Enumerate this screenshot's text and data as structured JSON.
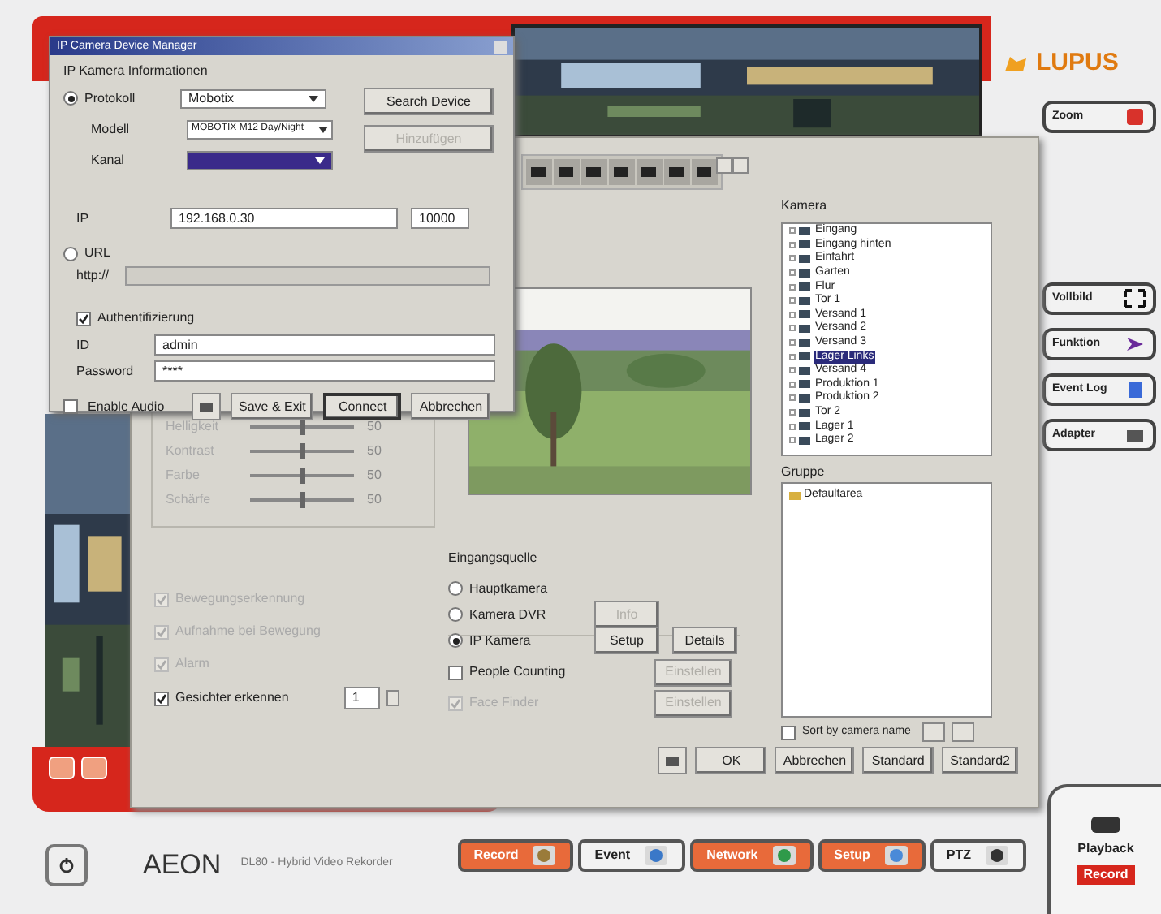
{
  "app": {
    "logo": "LUPUS",
    "side_buttons": [
      {
        "label": "Zoom",
        "kind": "zoom"
      },
      {
        "label": "Vollbild",
        "kind": "full"
      },
      {
        "label": "Funktion",
        "kind": "func"
      },
      {
        "label": "Event Log",
        "kind": "log"
      },
      {
        "label": "Adapter",
        "kind": "adapter"
      }
    ],
    "brand": "AEON",
    "subtitle": "DL80 - Hybrid Video Rekorder",
    "nav": [
      {
        "label": "Record",
        "selected": true
      },
      {
        "label": "Event",
        "selected": false
      },
      {
        "label": "Network",
        "selected": true
      },
      {
        "label": "Setup",
        "selected": true
      },
      {
        "label": "PTZ",
        "selected": false
      }
    ],
    "corner": [
      {
        "label": "Playback"
      },
      {
        "label": "Record"
      }
    ]
  },
  "settings": {
    "sliders": [
      {
        "label": "Helligkeit",
        "level": 0.5,
        "reading": "50"
      },
      {
        "label": "Kontrast",
        "level": 0.5,
        "reading": "50"
      },
      {
        "label": "Farbe",
        "level": 0.5,
        "reading": "50"
      },
      {
        "label": "Schärfe",
        "level": 0.5,
        "reading": "50"
      }
    ],
    "checkboxes": [
      {
        "label": "Bewegungserkennung",
        "checked": true,
        "disabled": true
      },
      {
        "label": "Aufnahme bei Bewegung",
        "checked": true,
        "disabled": true
      },
      {
        "label": "Alarm",
        "checked": true,
        "disabled": true
      },
      {
        "label": "Gesichter erkennen",
        "checked": true,
        "disabled": false
      }
    ],
    "spin_value": "1",
    "source": {
      "title": "Eingangsquelle",
      "options": [
        {
          "label": "Hauptkamera",
          "selected": false
        },
        {
          "label": "Kamera DVR",
          "selected": false
        },
        {
          "label": "IP Kamera",
          "selected": true
        }
      ],
      "buttons": [
        {
          "label": "Info",
          "disabled": true
        },
        {
          "label": "Setup",
          "disabled": false
        },
        {
          "label": "Details",
          "disabled": false
        }
      ]
    },
    "extras": [
      {
        "label": "People Counting",
        "checked": false,
        "disabled": false,
        "button": "Einstellen"
      },
      {
        "label": "Face Finder",
        "checked": true,
        "disabled": true,
        "button": "Einstellen"
      }
    ],
    "camera_list": {
      "title": "Kamera",
      "items": [
        {
          "label": "Eingang",
          "selected": false
        },
        {
          "label": "Eingang hinten",
          "selected": false
        },
        {
          "label": "Einfahrt",
          "selected": false
        },
        {
          "label": "Garten",
          "selected": false
        },
        {
          "label": "Flur",
          "selected": false
        },
        {
          "label": "Tor 1",
          "selected": false
        },
        {
          "label": "Versand 1",
          "selected": false
        },
        {
          "label": "Versand 2",
          "selected": false
        },
        {
          "label": "Versand 3",
          "selected": false
        },
        {
          "label": "Lager Links",
          "selected": true
        },
        {
          "label": "Versand 4",
          "selected": false
        },
        {
          "label": "Produktion 1",
          "selected": false
        },
        {
          "label": "Produktion 2",
          "selected": false
        },
        {
          "label": "Tor 2",
          "selected": false
        },
        {
          "label": "Lager 1",
          "selected": false
        },
        {
          "label": "Lager 2",
          "selected": false
        }
      ]
    },
    "group_list": {
      "title": "Gruppe",
      "items": [
        {
          "label": "Defaultarea"
        }
      ]
    },
    "sort": {
      "label": "Sort by camera name",
      "checked": false
    },
    "footer_buttons": [
      "OK",
      "Abbrechen",
      "Standard",
      "Standard2"
    ]
  },
  "device_manager": {
    "title": "IP Camera Device Manager",
    "section": "IP Kamera Informationen",
    "protocol": {
      "label": "Protokoll",
      "value": "Mobotix",
      "selected": true
    },
    "model": {
      "label": "Modell",
      "value": "MOBOTIX M12 Day/Night"
    },
    "channel": {
      "label": "Kanal"
    },
    "ip": {
      "label": "IP",
      "value": "192.168.0.30",
      "port": "10000"
    },
    "url": {
      "label": "URL",
      "selected": false,
      "field_label": "http://"
    },
    "auth": {
      "label": "Authentifizierung",
      "checked": true
    },
    "id": {
      "label": "ID",
      "value": "admin"
    },
    "password": {
      "label": "Password",
      "value": "****"
    },
    "audio": {
      "label": "Enable Audio",
      "checked": false
    },
    "side_buttons": [
      {
        "label": "Search Device",
        "disabled": false
      },
      {
        "label": "Hinzufügen",
        "disabled": true
      }
    ],
    "buttons": [
      "Save & Exit",
      "Connect",
      "Abbrechen"
    ]
  }
}
